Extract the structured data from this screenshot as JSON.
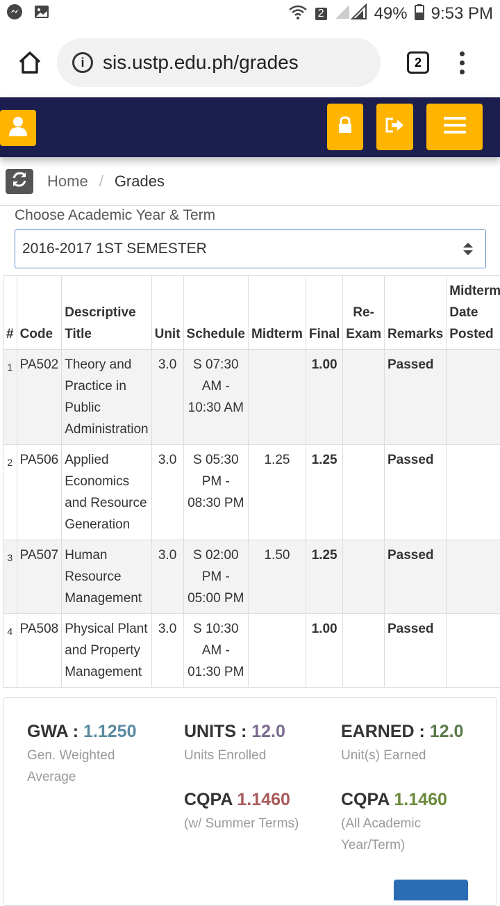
{
  "status_bar": {
    "battery": "49%",
    "time": "9:53 PM",
    "notification_count": "2"
  },
  "browser": {
    "url": "sis.ustp.edu.ph/grades",
    "tab_count": "2"
  },
  "breadcrumb": {
    "home": "Home",
    "separator": "/",
    "current": "Grades"
  },
  "term_selector": {
    "label": "Choose Academic Year & Term",
    "selected": "2016-2017 1ST SEMESTER"
  },
  "table": {
    "headers": {
      "num": "#",
      "code": "Code",
      "title": "Descriptive Title",
      "unit": "Unit",
      "schedule": "Schedule",
      "midterm": "Midterm",
      "final": "Final",
      "reexam": "Re-Exam",
      "remarks": "Remarks",
      "midterm_date": "Midterm Date Posted"
    },
    "rows": [
      {
        "num": "1",
        "code": "PA502",
        "title": "Theory and Practice in Public Administration",
        "unit": "3.0",
        "schedule": "S 07:30 AM - 10:30 AM",
        "midterm": "",
        "final": "1.00",
        "reexam": "",
        "remarks": "Passed"
      },
      {
        "num": "2",
        "code": "PA506",
        "title": "Applied Economics and Resource Generation",
        "unit": "3.0",
        "schedule": "S 05:30 PM - 08:30 PM",
        "midterm": "1.25",
        "final": "1.25",
        "reexam": "",
        "remarks": "Passed"
      },
      {
        "num": "3",
        "code": "PA507",
        "title": "Human Resource Management",
        "unit": "3.0",
        "schedule": "S 02:00 PM - 05:00 PM",
        "midterm": "1.50",
        "final": "1.25",
        "reexam": "",
        "remarks": "Passed"
      },
      {
        "num": "4",
        "code": "PA508",
        "title": "Physical Plant and Property Management",
        "unit": "3.0",
        "schedule": "S 10:30 AM - 01:30 PM",
        "midterm": "",
        "final": "1.00",
        "reexam": "",
        "remarks": "Passed"
      }
    ]
  },
  "summary": {
    "gwa": {
      "label": "GWA :",
      "value": "1.1250",
      "sub": "Gen. Weighted Average",
      "color": "#5a8aa0"
    },
    "units": {
      "label": "UNITS :",
      "value": "12.0",
      "sub": "Units Enrolled",
      "color": "#7b6a8f"
    },
    "earned": {
      "label": "EARNED :",
      "value": "12.0",
      "sub": "Unit(s) Earned",
      "color": "#5a7a4a"
    },
    "cqpa_summer": {
      "label": "CQPA",
      "value": "1.1460",
      "sub": "(w/ Summer Terms)",
      "color": "#a85a5a"
    },
    "cqpa_all": {
      "label": "CQPA",
      "value": "1.1460",
      "sub": "(All Academic Year/Term)",
      "color": "#6a8a3a"
    }
  },
  "colors": {
    "navbar": "#1c1e4f",
    "accent_button": "#ffb400"
  }
}
